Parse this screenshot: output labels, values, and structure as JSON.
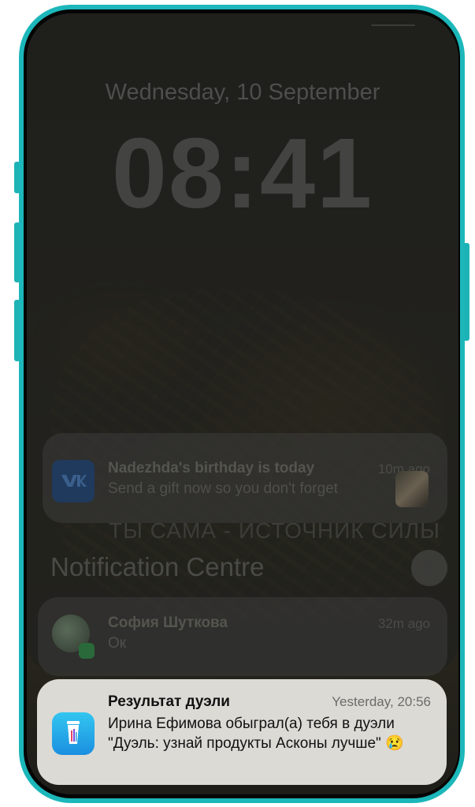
{
  "lockscreen": {
    "date": "Wednesday, 10 September",
    "time": "08:41"
  },
  "notifications_top": [
    {
      "app_icon": "vk-icon",
      "title": "Nadezhda's birthday is today",
      "body": "Send a gift now so you don't forget",
      "time": "10m ago"
    }
  ],
  "wallpaper_text": "ТЫ САМА - ИСТОЧНИК СИЛЫ",
  "notification_centre": {
    "title": "Notification Centre",
    "close_glyph": "✕",
    "items": [
      {
        "title": "София Шуткова",
        "body": "Ок",
        "time": "32m ago"
      }
    ]
  },
  "active_notification": {
    "app_icon": "duel-app-icon",
    "title": "Результат дуэли",
    "time": "Yesterday, 20:56",
    "body": "Ирина Ефимова обыграл(а) тебя в дуэли \"Дуэль: узнай продукты Асконы лучше\" 😢"
  },
  "colors": {
    "frame_accent": "#1cb7ba",
    "app_icon_blue": "#1a8fe0"
  }
}
